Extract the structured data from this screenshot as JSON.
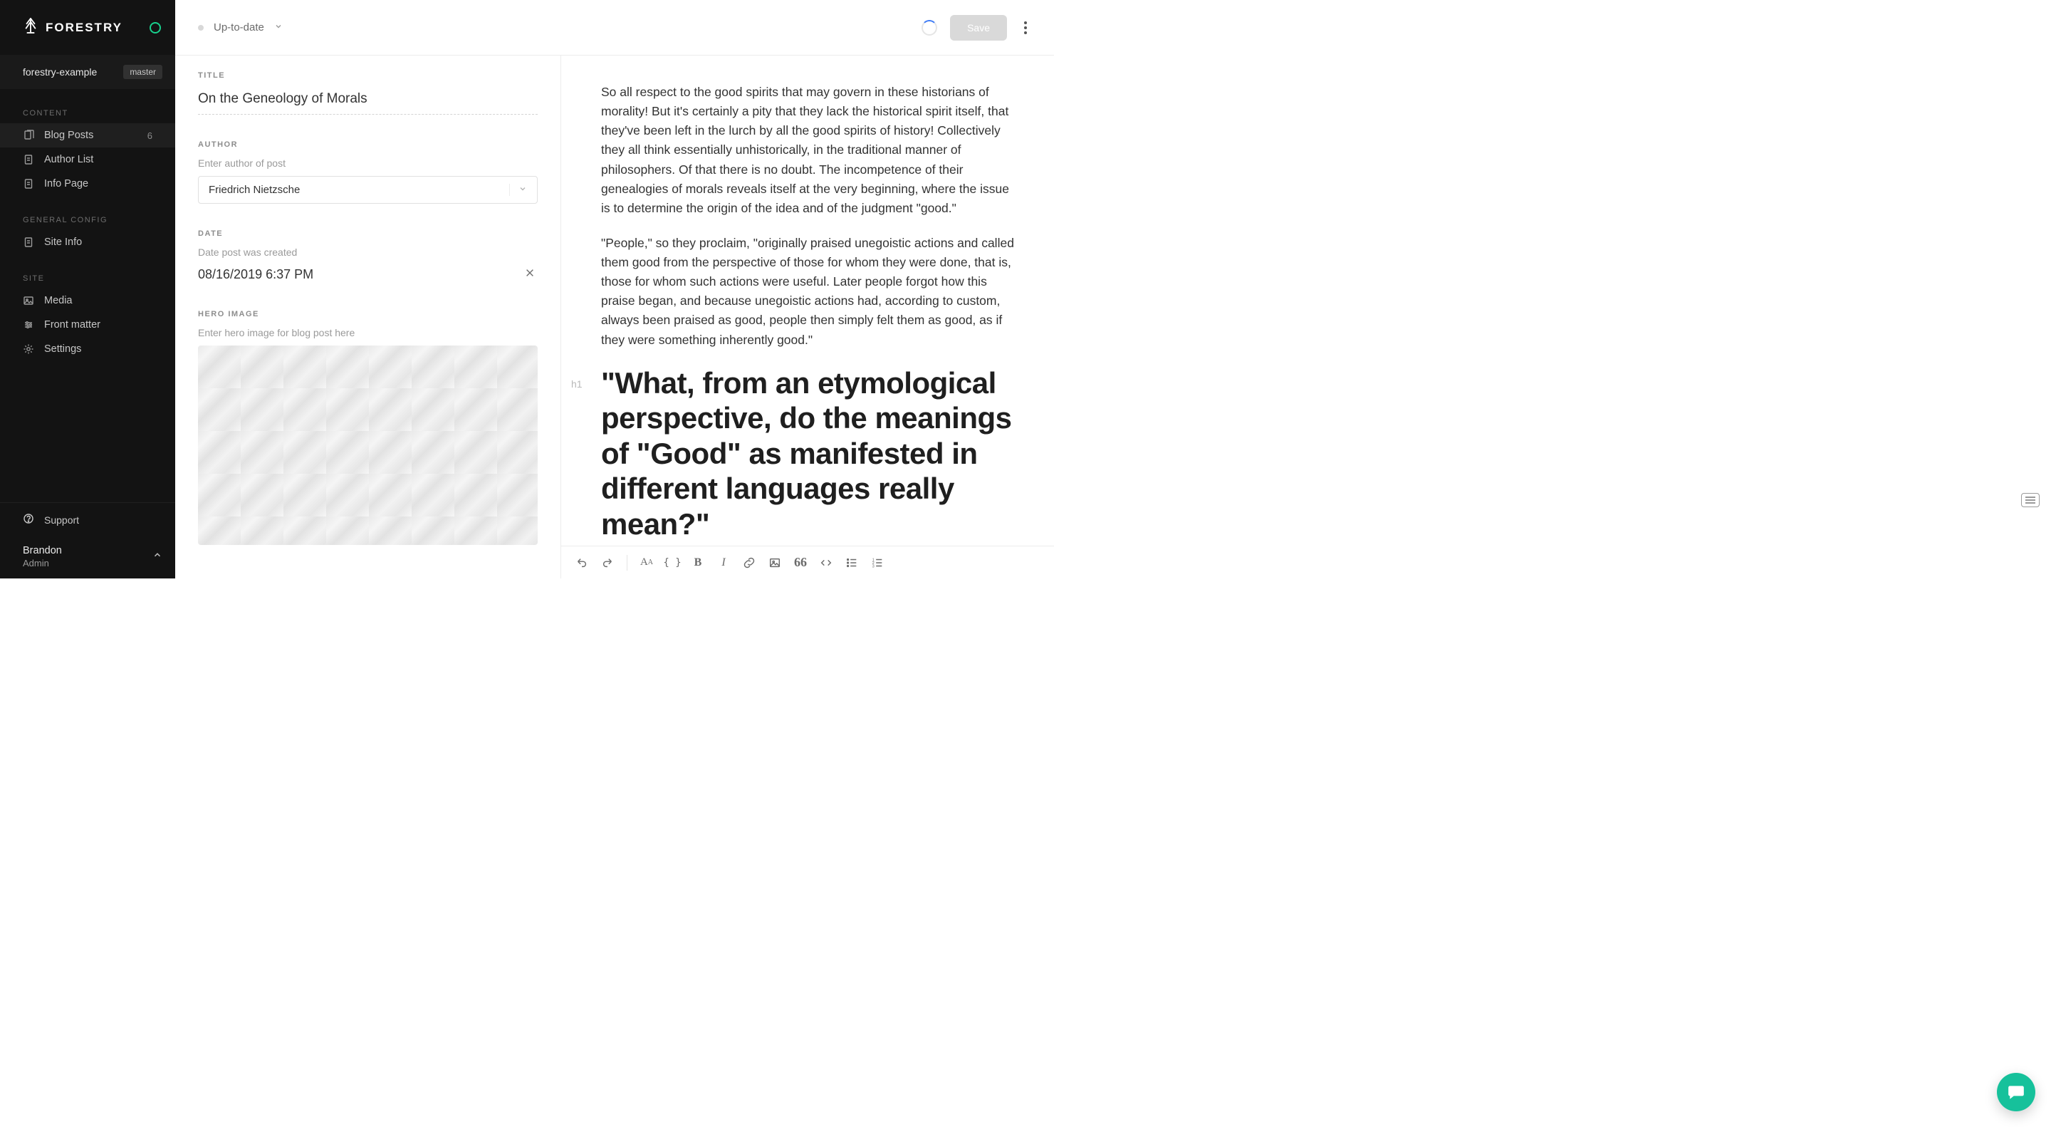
{
  "brand": {
    "name": "FORESTRY"
  },
  "repo": {
    "name": "forestry-example",
    "branch": "master"
  },
  "sidebar": {
    "sections": [
      {
        "heading": "CONTENT",
        "items": [
          {
            "label": "Blog Posts",
            "count": "6",
            "icon": "pages-icon"
          },
          {
            "label": "Author List",
            "icon": "page-icon"
          },
          {
            "label": "Info Page",
            "icon": "page-icon"
          }
        ]
      },
      {
        "heading": "GENERAL CONFIG",
        "items": [
          {
            "label": "Site Info",
            "icon": "page-icon"
          }
        ]
      },
      {
        "heading": "SITE",
        "items": [
          {
            "label": "Media",
            "icon": "image-icon"
          },
          {
            "label": "Front matter",
            "icon": "sliders-icon"
          },
          {
            "label": "Settings",
            "icon": "gear-icon"
          }
        ]
      }
    ],
    "support_label": "Support",
    "user": {
      "name": "Brandon",
      "role": "Admin"
    }
  },
  "topbar": {
    "status_text": "Up-to-date",
    "save_label": "Save"
  },
  "fields": {
    "title": {
      "label": "TITLE",
      "value": "On the Geneology of Morals"
    },
    "author": {
      "label": "AUTHOR",
      "help": "Enter author of post",
      "value": "Friedrich Nietzsche"
    },
    "date": {
      "label": "DATE",
      "help": "Date post was created",
      "value": "08/16/2019 6:37 PM"
    },
    "hero": {
      "label": "HERO IMAGE",
      "help": "Enter hero image for blog post here"
    }
  },
  "document": {
    "p1": "So all respect to the good spirits that may govern in these historians of morality! But it's certainly a pity that they lack the historical spirit itself, that they've been left in the lurch by all the good spirits of history! Collectively they all think essentially unhistorically, in the traditional manner of philosophers. Of that there is no doubt. The incompetence of their genealogies of morals reveals itself at the very beginning, where the issue is to determine the origin of the idea and of the judgment \"good.\"",
    "p2": "\"People,\" so they proclaim, \"originally praised unegoistic actions and called them good from the perspective of those for whom they were done, that is, those for whom such actions were useful. Later people forgot how this praise began, and because unegoistic actions had, according to custom, always been praised as good, people then simply felt them as good, as if they were something inherently good.\"",
    "h1_marker": "h1",
    "h1": "\"What, from an etymological perspective, do the meanings of \"Good\" as manifested in different languages really mean?\""
  },
  "editor_toolbar": {
    "undo": "undo",
    "redo": "redo",
    "size": "A",
    "brackets": "{}",
    "bold": "B",
    "italic": "I",
    "link": "link",
    "image": "image",
    "quote": "quote",
    "code": "code",
    "ul": "ul",
    "ol": "ol"
  }
}
